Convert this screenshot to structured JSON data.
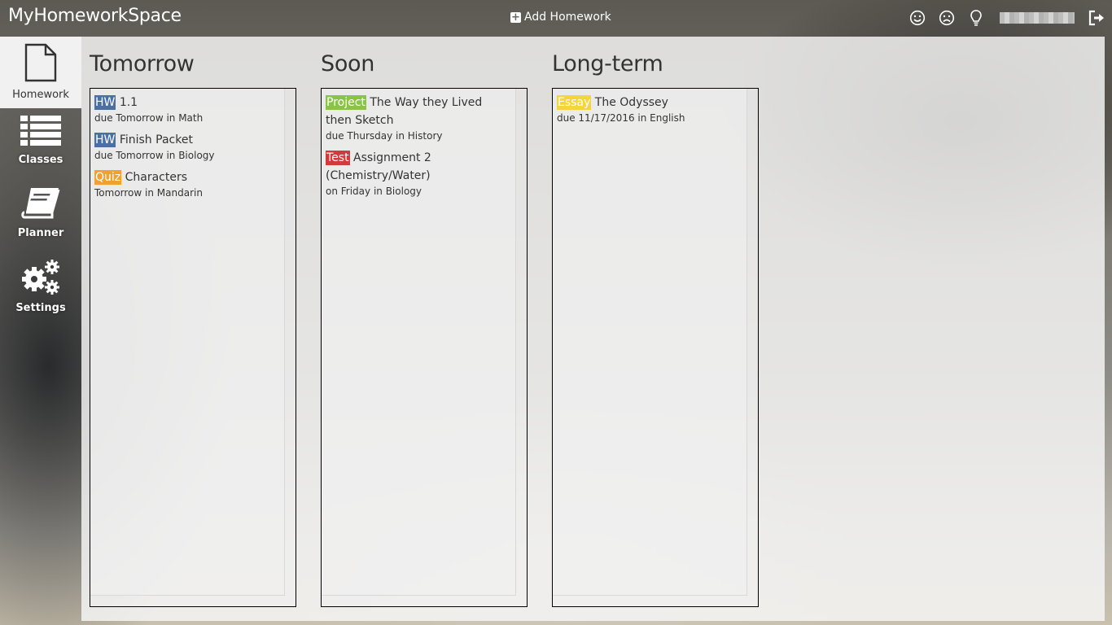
{
  "app": {
    "title": "MyHomeworkSpace"
  },
  "topbar": {
    "add_homework_label": "Add Homework"
  },
  "sidebar": {
    "items": [
      {
        "label": "Homework",
        "icon": "document-icon",
        "active": true
      },
      {
        "label": "Classes",
        "icon": "list-icon",
        "active": false
      },
      {
        "label": "Planner",
        "icon": "book-icon",
        "active": false
      },
      {
        "label": "Settings",
        "icon": "gears-icon",
        "active": false
      }
    ]
  },
  "columns": [
    {
      "title": "Tomorrow",
      "items": [
        {
          "tag": "HW",
          "tag_color": "#4b6fa0",
          "name": "1.1",
          "due": "due Tomorrow in Math"
        },
        {
          "tag": "HW",
          "tag_color": "#4b6fa0",
          "name": "Finish Packet",
          "due": "due Tomorrow in Biology"
        },
        {
          "tag": "Quiz",
          "tag_color": "#f0a132",
          "name": "Characters",
          "due": "Tomorrow in Mandarin"
        }
      ]
    },
    {
      "title": "Soon",
      "items": [
        {
          "tag": "Project",
          "tag_color": "#8bc34a",
          "name": "The Way they Lived then Sketch",
          "due": "due Thursday in History"
        },
        {
          "tag": "Test",
          "tag_color": "#d03c3c",
          "name": "Assignment 2 (Chemistry/Water)",
          "due": "on Friday in Biology"
        }
      ]
    },
    {
      "title": "Long-term",
      "items": [
        {
          "tag": "Essay",
          "tag_color": "#f5d53a",
          "name": "The Odyssey",
          "due": "due 11/17/2016 in English"
        }
      ]
    }
  ]
}
